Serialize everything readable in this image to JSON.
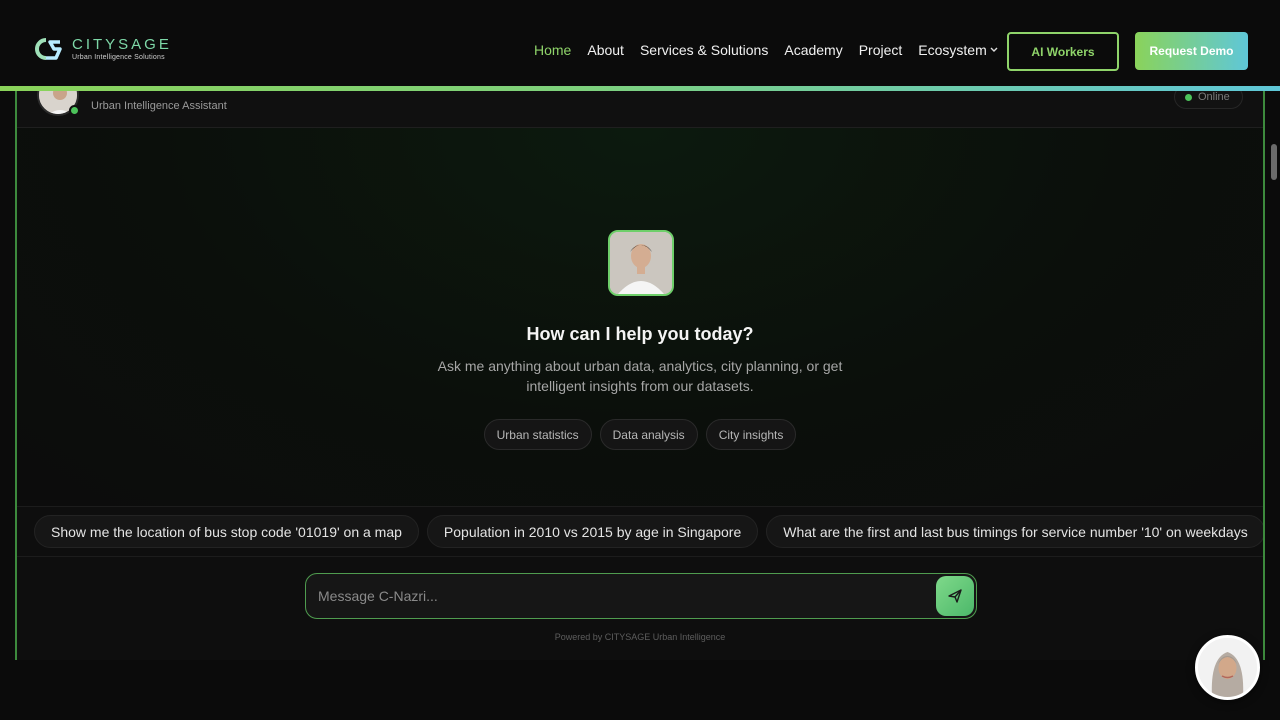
{
  "brand": {
    "name": "CITYSAGE",
    "tagline": "Urban Intelligence Solutions",
    "accent": "#8fd46a",
    "gradient_end": "#5fc7d8"
  },
  "nav": {
    "links": [
      {
        "label": "Home",
        "active": true
      },
      {
        "label": "About",
        "active": false
      },
      {
        "label": "Services & Solutions",
        "active": false
      },
      {
        "label": "Academy",
        "active": false
      },
      {
        "label": "Project",
        "active": false
      },
      {
        "label": "Ecosystem",
        "active": false,
        "dropdown": true
      }
    ],
    "ai_workers_label": "AI Workers",
    "request_demo_label": "Request Demo"
  },
  "chat": {
    "header": {
      "subtitle": "Urban Intelligence Assistant",
      "status": "Online"
    },
    "welcome": {
      "title": "How can I help you today?",
      "text": "Ask me anything about urban data, analytics, city planning, or get intelligent insights from our datasets."
    },
    "chips": [
      "Urban statistics",
      "Data analysis",
      "City insights"
    ],
    "suggestions": [
      "Show me the location of bus stop code '01019' on a map",
      "Population in 2010 vs 2015 by age in Singapore",
      "What are the first and last bus timings for service number '10' on weekdays"
    ],
    "input_placeholder": "Message C-Nazri...",
    "powered_by": "Powered by CITYSAGE Urban Intelligence"
  },
  "icons": {
    "send": "send-icon",
    "chevron": "chevron-down-icon",
    "logo": "citysage-logo-icon"
  }
}
